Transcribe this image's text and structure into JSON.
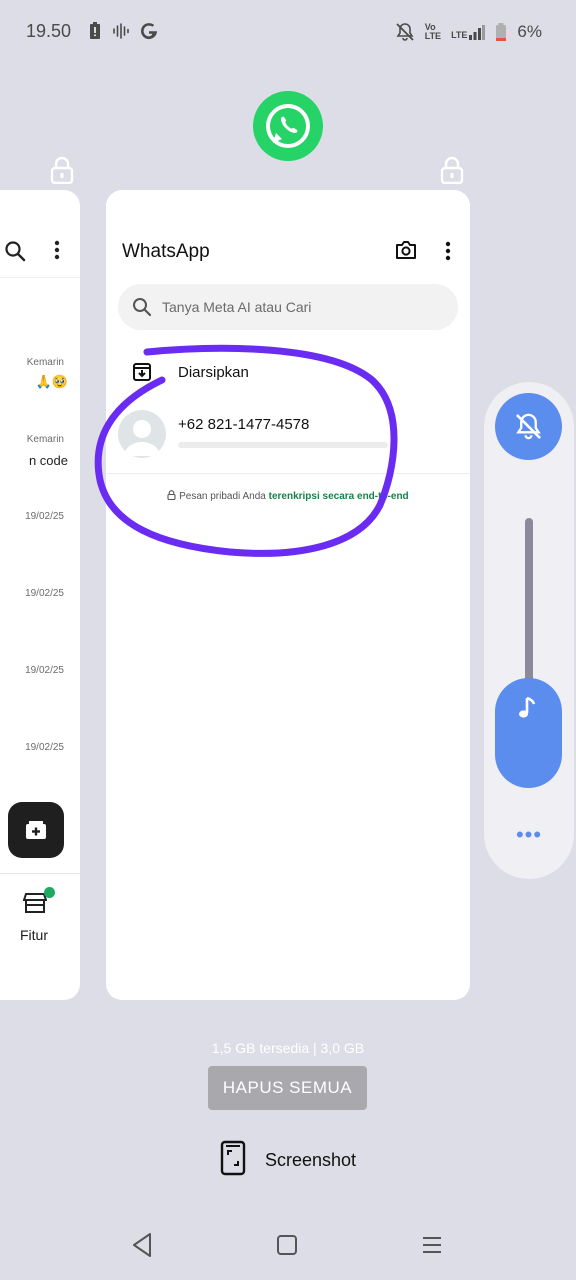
{
  "status_bar": {
    "time": "19.50",
    "battery": "6%"
  },
  "left_card": {
    "times": [
      "Kemarin",
      "Kemarin",
      "19/02/25",
      "19/02/25",
      "19/02/25",
      "19/02/25"
    ],
    "snippet": "n code",
    "tab_label": "Fitur"
  },
  "whatsapp": {
    "title": "WhatsApp",
    "search_placeholder": "Tanya Meta AI atau Cari",
    "archived_label": "Diarsipkan",
    "contact_name": "+62 821-1477-4578",
    "e2e_prefix": "Pesan pribadi Anda ",
    "e2e_link": "terenkripsi secara end-to-end"
  },
  "recents": {
    "memory_text": "1,5 GB tersedia | 3,0 GB",
    "clear_all_label": "HAPUS SEMUA",
    "screenshot_label": "Screenshot"
  },
  "colors": {
    "accent": "#5b8def",
    "whatsapp_green": "#25d366",
    "annotation": "#6a2bf2"
  }
}
